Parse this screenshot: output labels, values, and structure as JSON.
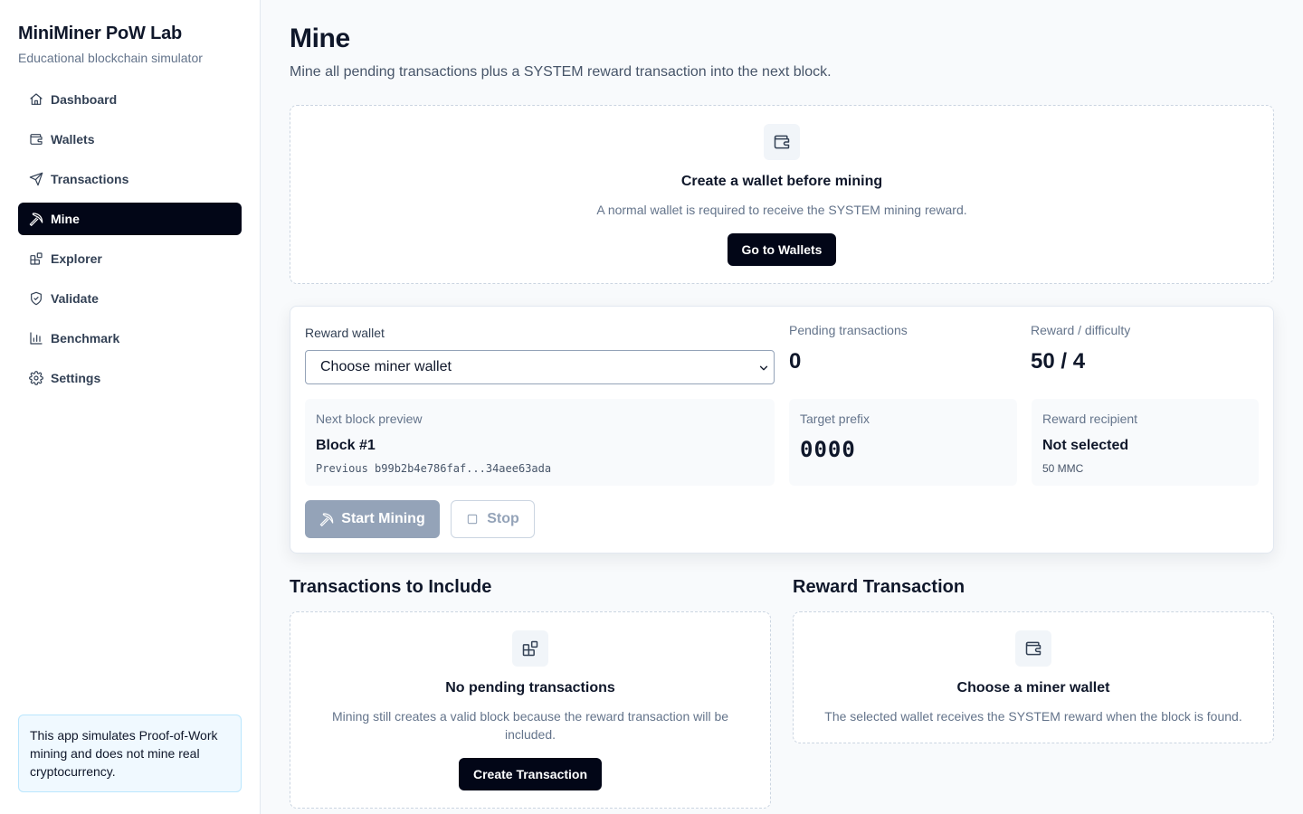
{
  "sidebar": {
    "brand_title": "MiniMiner PoW Lab",
    "brand_subtitle": "Educational blockchain simulator",
    "items": [
      {
        "label": "Dashboard",
        "icon": "home-icon"
      },
      {
        "label": "Wallets",
        "icon": "wallet-icon"
      },
      {
        "label": "Transactions",
        "icon": "send-icon"
      },
      {
        "label": "Mine",
        "icon": "pickaxe-icon",
        "active": true
      },
      {
        "label": "Explorer",
        "icon": "blocks-icon"
      },
      {
        "label": "Validate",
        "icon": "shield-check-icon"
      },
      {
        "label": "Benchmark",
        "icon": "bar-chart-icon"
      },
      {
        "label": "Settings",
        "icon": "gear-icon"
      }
    ],
    "notice": "This app simulates Proof-of-Work mining and does not mine real cryptocurrency."
  },
  "page": {
    "title": "Mine",
    "description": "Mine all pending transactions plus a SYSTEM reward transaction into the next block."
  },
  "wallet_notice": {
    "icon": "wallet-icon",
    "title": "Create a wallet before mining",
    "description": "A normal wallet is required to receive the SYSTEM mining reward.",
    "button": "Go to Wallets"
  },
  "mining": {
    "reward_wallet_label": "Reward wallet",
    "reward_wallet_value": "Choose miner wallet",
    "pending_label": "Pending transactions",
    "pending_value": "0",
    "reward_difficulty_label": "Reward / difficulty",
    "reward_difficulty_value": "50 / 4",
    "next_block_label": "Next block preview",
    "next_block_value": "Block #1",
    "previous_hash": "Previous b99b2b4e786faf...34aee63ada",
    "target_prefix_label": "Target prefix",
    "target_prefix_value": "0000",
    "reward_recipient_label": "Reward recipient",
    "reward_recipient_value": "Not selected",
    "reward_amount": "50 MMC",
    "start_button": "Start Mining",
    "stop_button": "Stop"
  },
  "transactions_section": {
    "title": "Transactions to Include",
    "icon": "blocks-icon",
    "empty_title": "No pending transactions",
    "empty_description": "Mining still creates a valid block because the reward transaction will be included.",
    "button": "Create Transaction"
  },
  "reward_section": {
    "title": "Reward Transaction",
    "icon": "wallet-icon",
    "empty_title": "Choose a miner wallet",
    "empty_description": "The selected wallet receives the SYSTEM reward when the block is found."
  }
}
